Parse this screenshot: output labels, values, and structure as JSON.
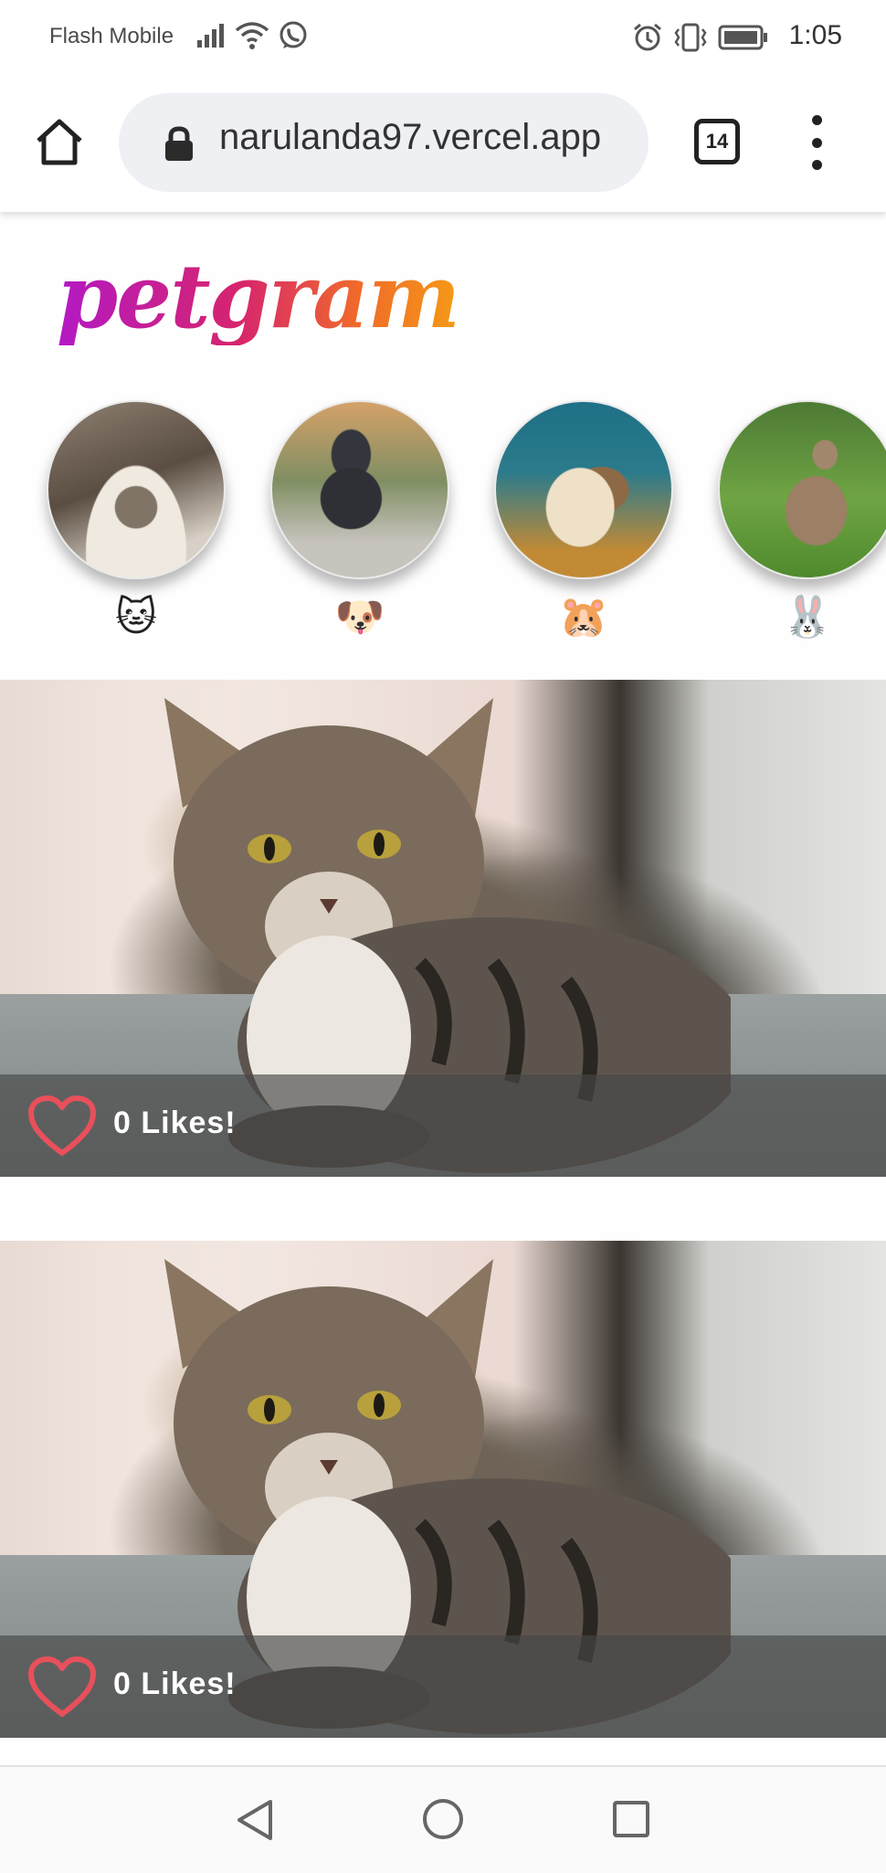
{
  "status_bar": {
    "carrier": "Flash Mobile",
    "time": "1:05",
    "icons_left": [
      "signal-icon",
      "wifi-icon",
      "whatsapp-icon"
    ],
    "icons_right": [
      "alarm-icon",
      "vibrate-icon",
      "battery-icon"
    ]
  },
  "browser": {
    "url": "narulanda97.vercel.app",
    "tab_count": "14"
  },
  "app": {
    "logo": "petgram"
  },
  "categories": [
    {
      "emoji": "🐱"
    },
    {
      "emoji": "🐶"
    },
    {
      "emoji": "🐹"
    },
    {
      "emoji": "🐰"
    }
  ],
  "posts": [
    {
      "likes_text": "0 Likes!"
    },
    {
      "likes_text": "0 Likes!"
    }
  ],
  "colors": {
    "heart": "#e8505b",
    "logo_gradient": [
      "#b319c4",
      "#d6246e",
      "#f06a2a",
      "#f59a16"
    ]
  }
}
